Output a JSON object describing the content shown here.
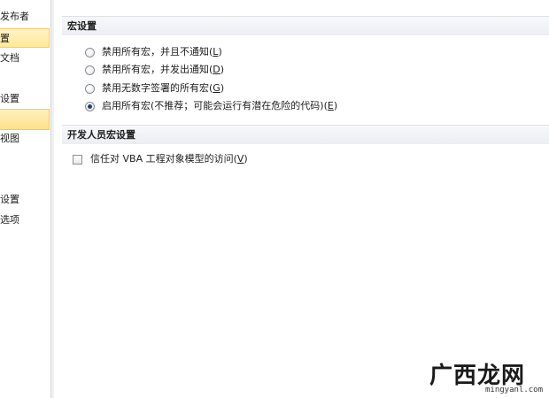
{
  "sidebar": {
    "items": [
      {
        "label": "发布者"
      },
      {
        "label": "置"
      },
      {
        "label": "文档"
      },
      {
        "label": "设置"
      },
      {
        "label": ""
      },
      {
        "label": "视图"
      },
      {
        "label": "设置"
      },
      {
        "label": "选项"
      }
    ]
  },
  "macro_settings": {
    "header": "宏设置",
    "options": [
      {
        "text": "禁用所有宏，并且不通知(",
        "key": "L",
        "tail": ")",
        "selected": false
      },
      {
        "text": "禁用所有宏，并发出通知(",
        "key": "D",
        "tail": ")",
        "selected": false
      },
      {
        "text": "禁用无数字签署的所有宏(",
        "key": "G",
        "tail": ")",
        "selected": false
      },
      {
        "text": "启用所有宏(不推荐；可能会运行有潜在危险的代码)(",
        "key": "E",
        "tail": ")",
        "selected": true
      }
    ]
  },
  "developer_settings": {
    "header": "开发人员宏设置",
    "trust_vba": {
      "text": "信任对 VBA 工程对象模型的访问(",
      "key": "V",
      "tail": ")",
      "checked": false
    }
  },
  "watermark": {
    "text": "广西龙网",
    "url": "mingyanl.com"
  },
  "colors": {
    "highlight": "#fde99a",
    "header_bg": "#eceef3",
    "radio_dot": "#23406d"
  }
}
